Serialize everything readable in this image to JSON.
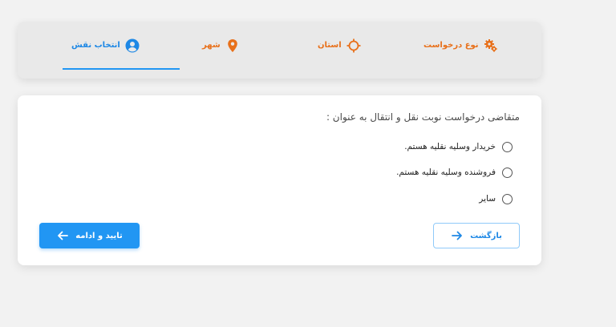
{
  "stepper": {
    "steps": [
      {
        "label": "نوع درخواست",
        "icon": "gears-icon",
        "state": "done"
      },
      {
        "label": "استان",
        "icon": "crosshair-icon",
        "state": "done"
      },
      {
        "label": "شهر",
        "icon": "map-pin-icon",
        "state": "done"
      },
      {
        "label": "انتخاب نقش",
        "icon": "user-circle-icon",
        "state": "active"
      }
    ],
    "nav_icon": "chevron-left-icon",
    "colors": {
      "done": "#e8701a",
      "active": "#1e88e5"
    }
  },
  "form": {
    "question": "متقاضی درخواست نوبت نقل و انتقال به عنوان :",
    "options": [
      {
        "label": "خریدار وسلیه نقلیه هستم.",
        "selected": false
      },
      {
        "label": "فروشنده وسلیه نقلیه هستم.",
        "selected": false
      },
      {
        "label": "سایر",
        "selected": false
      }
    ]
  },
  "actions": {
    "confirm_label": "تایید و ادامه",
    "back_label": "بازگشت",
    "accent": "#2196f3"
  }
}
